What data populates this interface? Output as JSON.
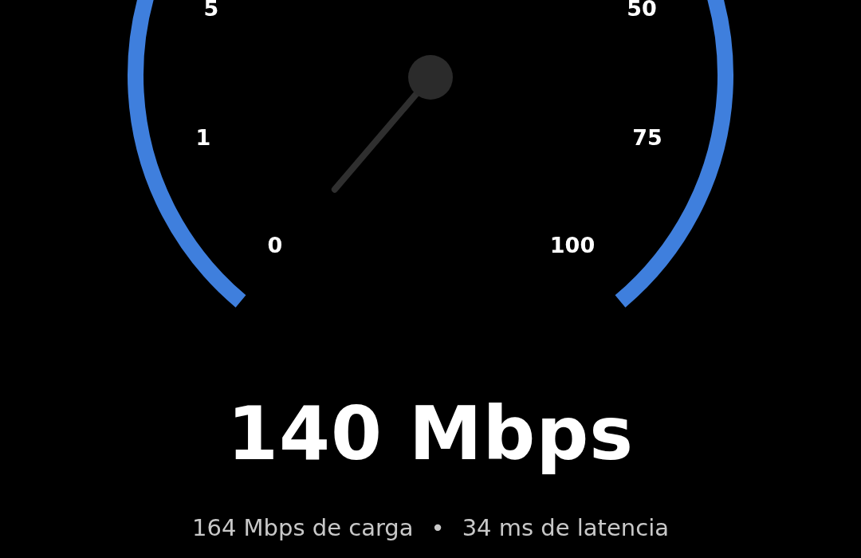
{
  "gauge": {
    "labels": [
      "0",
      "1",
      "5",
      "50",
      "75",
      "100"
    ]
  },
  "speed": {
    "value": "140 Mbps"
  },
  "details": [
    {
      "text": "164 Mbps de carga"
    },
    {
      "text": "•"
    },
    {
      "text": "34 ms de latencia"
    }
  ]
}
